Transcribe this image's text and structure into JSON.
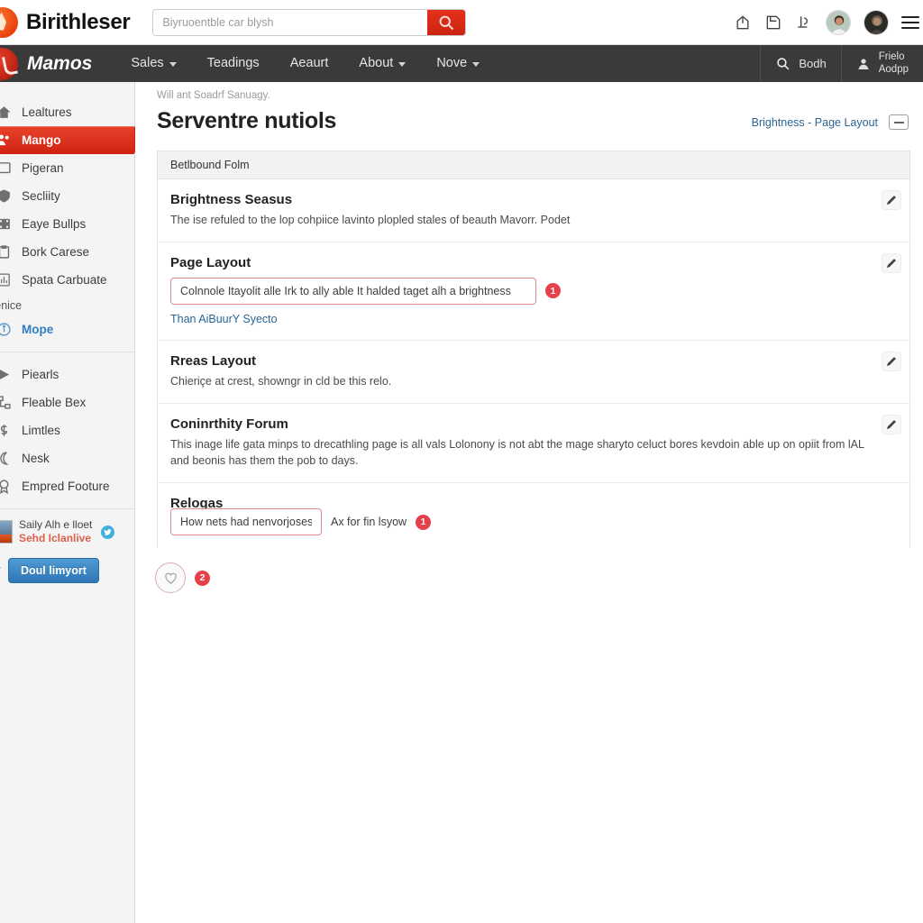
{
  "topbar": {
    "brand": "Birithleser",
    "search_value": "",
    "search_placeholder": "Biyruoentble car blysh",
    "search_button_icon": "search-icon",
    "icons": [
      "share-icon",
      "save-icon",
      "scale-icon"
    ],
    "menu_icon": "hamburger-icon"
  },
  "nav": {
    "brand": "Mamos",
    "items": [
      {
        "label": "Sales",
        "caret": true
      },
      {
        "label": "Teadings",
        "caret": false
      },
      {
        "label": "Aeaurt",
        "caret": false
      },
      {
        "label": "About",
        "caret": true
      },
      {
        "label": "Nove",
        "caret": true
      }
    ],
    "search_label": "Bodh",
    "user_line1": "Frielo",
    "user_line2": "Aodpp"
  },
  "sidebar": {
    "items": [
      {
        "label": "Lealtures",
        "icon": "home-icon",
        "active": false
      },
      {
        "label": "Mango",
        "icon": "users-icon",
        "active": true
      },
      {
        "label": "Pigeran",
        "icon": "square-icon",
        "active": false
      },
      {
        "label": "Secliity",
        "icon": "shield-icon",
        "active": false
      },
      {
        "label": "Eaye Bullps",
        "icon": "film-icon",
        "active": false
      },
      {
        "label": "Bork Carese",
        "icon": "clipboard-icon",
        "active": false
      },
      {
        "label": "Spata Carbuate",
        "icon": "chart-icon",
        "active": false
      }
    ],
    "caption": "Ilenice",
    "link_item": {
      "label": "Mope",
      "icon": "info-icon"
    },
    "items2": [
      {
        "label": "Piearls",
        "icon": "play-icon"
      },
      {
        "label": "Fleable Bex",
        "icon": "flow-icon"
      },
      {
        "label": "Limtles",
        "icon": "dollar-icon"
      },
      {
        "label": "Nesk",
        "icon": "moon-icon"
      },
      {
        "label": "Empred Footure",
        "icon": "badge-icon"
      }
    ],
    "user": {
      "name": "Saily Alh e lloet",
      "sub": "Sehd Iclanlive",
      "badge_icon": "twitter-icon",
      "avatar": "user-thumbnail"
    },
    "import_button": "Doul limyort",
    "import_icon": "trash-icon"
  },
  "main": {
    "breadcrumb": "Will ant Soadrf Sanuagy.",
    "title": "Serventre nutiols",
    "head_link": "Brightness - Page Layout",
    "toggle_icon": "collapse-icon",
    "panel_header": "Betlbound Folm",
    "sections": [
      {
        "title": "Brightness Seasus",
        "desc": "The ise refuled to the lop cohpiice lavinto plopled stales of beauth Mavorr. Podet",
        "edit_icon": "pencil-icon"
      },
      {
        "title": "Page Layout",
        "field_value": "Colnnole Itayolit alle Irk to ally able It halded taget alh a brightness",
        "field_marker": "1",
        "sub_link": "Than AiBuurY Syecto",
        "edit_icon": "pencil-icon"
      },
      {
        "title": "Rreas Layout",
        "desc": "Chieriçe at crest, showngr in cld be this relo.",
        "edit_icon": "pencil-icon"
      },
      {
        "title": "Coninrthity Forum",
        "desc": "This inage life gata minps to drecathling page is all vals Lolonony is not abt the mage sharyto celuct bores kevdoin able up on opiit from lAL and beonis has them the pob to days.",
        "edit_icon": "pencil-icon"
      },
      {
        "title": "Relogas",
        "field_value": "How nets had nenvorjosest",
        "field_note": "Ax for fin lsyow",
        "field_marker": "1",
        "edit_icon": "pencil-icon"
      }
    ],
    "floating": {
      "icon": "heart-icon",
      "marker": "2"
    }
  },
  "colors": {
    "accent_red": "#d2260f",
    "marker_red": "#e8404a",
    "link_blue": "#2a6496",
    "nav_dark": "#3a3a3a",
    "button_blue": "#2f77b5"
  }
}
